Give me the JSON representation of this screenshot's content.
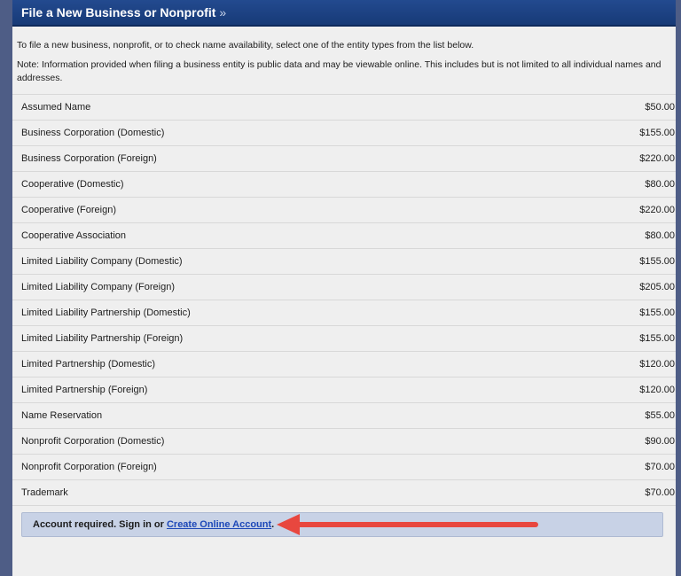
{
  "header": {
    "title": "File a New Business or Nonprofit",
    "chevron": "»"
  },
  "intro": {
    "line1": "To file a new business, nonprofit, or to check name availability, select one of the entity types from the list below.",
    "line2": "Note: Information provided when filing a business entity is public data and may be viewable online. This includes but is not limited to all individual names and addresses."
  },
  "entities": [
    {
      "name": "Assumed Name",
      "fee": "$50.00"
    },
    {
      "name": "Business Corporation (Domestic)",
      "fee": "$155.00"
    },
    {
      "name": "Business Corporation (Foreign)",
      "fee": "$220.00"
    },
    {
      "name": "Cooperative (Domestic)",
      "fee": "$80.00"
    },
    {
      "name": "Cooperative (Foreign)",
      "fee": "$220.00"
    },
    {
      "name": "Cooperative Association",
      "fee": "$80.00"
    },
    {
      "name": "Limited Liability Company (Domestic)",
      "fee": "$155.00"
    },
    {
      "name": "Limited Liability Company (Foreign)",
      "fee": "$205.00"
    },
    {
      "name": "Limited Liability Partnership (Domestic)",
      "fee": "$155.00"
    },
    {
      "name": "Limited Liability Partnership (Foreign)",
      "fee": "$155.00"
    },
    {
      "name": "Limited Partnership (Domestic)",
      "fee": "$120.00"
    },
    {
      "name": "Limited Partnership (Foreign)",
      "fee": "$120.00"
    },
    {
      "name": "Name Reservation",
      "fee": "$55.00"
    },
    {
      "name": "Nonprofit Corporation (Domestic)",
      "fee": "$90.00"
    },
    {
      "name": "Nonprofit Corporation (Foreign)",
      "fee": "$70.00"
    },
    {
      "name": "Trademark",
      "fee": "$70.00"
    }
  ],
  "notice": {
    "prefix": "Account required. Sign in or ",
    "link": "Create Online Account",
    "suffix": "."
  },
  "colors": {
    "arrow": "#e8473f",
    "header": "#1d4183",
    "link": "#1d48b8"
  }
}
